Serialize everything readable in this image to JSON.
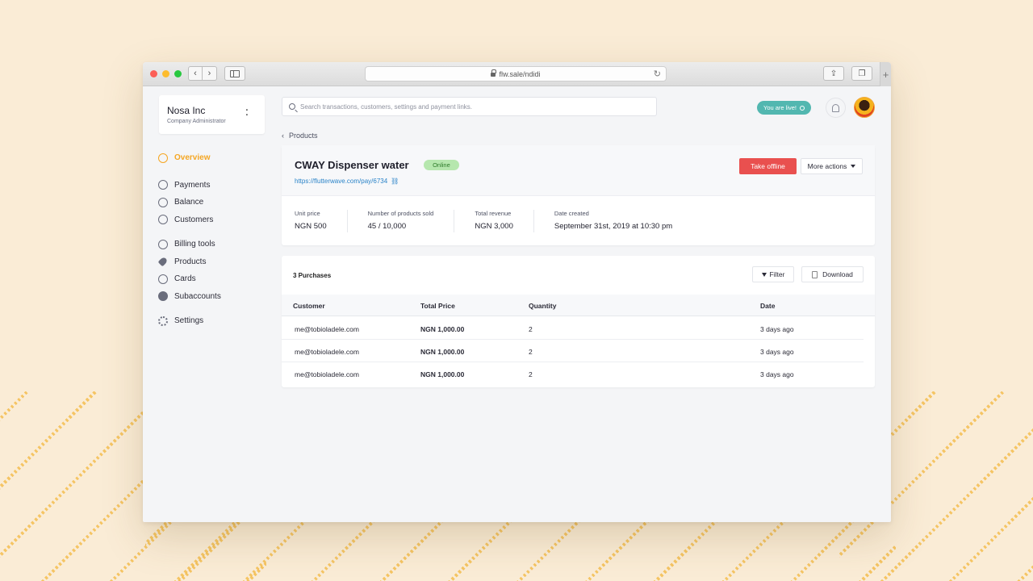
{
  "browser": {
    "url": "flw.sale/ndidi",
    "new_tab_label": "+"
  },
  "org": {
    "name": "Nosa Inc",
    "role": "Company Administrator"
  },
  "nav": {
    "overview": "Overview",
    "payments": "Payments",
    "balance": "Balance",
    "customers": "Customers",
    "billing_tools": "Billing tools",
    "products": "Products",
    "cards": "Cards",
    "subaccounts": "Subaccounts",
    "settings": "Settings"
  },
  "search": {
    "placeholder": "Search transactions, customers, settings and payment links."
  },
  "live_badge": "You are live!",
  "breadcrumb": "Products",
  "product": {
    "title": "CWAY Dispenser water",
    "status": "Online",
    "link": "https://flutterwave.com/pay/6734",
    "take_offline": "Take offline",
    "more_actions": "More actions",
    "stats": [
      {
        "label": "Unit price",
        "value": "NGN 500"
      },
      {
        "label": "Number of products sold",
        "value": "45 / 10,000"
      },
      {
        "label": "Total revenue",
        "value": "NGN 3,000"
      },
      {
        "label": "Date created",
        "value": "September 31st, 2019 at 10:30 pm"
      }
    ]
  },
  "purchases": {
    "title": "3 Purchases",
    "filter": "Filter",
    "download": "Download",
    "columns": [
      "Customer",
      "Total Price",
      "Quantity",
      "Date"
    ],
    "rows": [
      {
        "customer": "me@tobioladele.com",
        "price": "NGN 1,000.00",
        "quantity": "2",
        "date": "3 days ago"
      },
      {
        "customer": "me@tobioladele.com",
        "price": "NGN 1,000.00",
        "quantity": "2",
        "date": "3 days ago"
      },
      {
        "customer": "me@tobioladele.com",
        "price": "NGN 1,000.00",
        "quantity": "2",
        "date": "3 days ago"
      }
    ]
  },
  "colors": {
    "accent_orange": "#f5a623",
    "danger_red": "#e9504f",
    "live_teal": "#52b7b0",
    "online_green": "#b6e7ae",
    "link_blue": "#2a83c8"
  }
}
